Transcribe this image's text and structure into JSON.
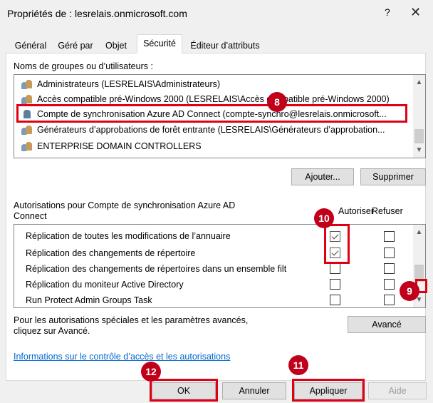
{
  "window": {
    "title": "Propriétés de : lesrelais.onmicrosoft.com",
    "help_label": "?",
    "close_label": "✕"
  },
  "tabs": [
    {
      "label": "Général"
    },
    {
      "label": "Géré par"
    },
    {
      "label": "Objet"
    },
    {
      "label": "Sécurité",
      "active": true
    },
    {
      "label": "Éditeur d’attributs"
    }
  ],
  "groups": {
    "label": "Noms de groupes ou d’utilisateurs :",
    "items": [
      {
        "label": "Administrateurs (LESRELAIS\\Administrateurs)",
        "icon": "group-icon"
      },
      {
        "label": "Accès compatible pré-Windows 2000 (LESRELAIS\\Accès compatible pré-Windows 2000)",
        "icon": "group-icon"
      },
      {
        "label": "Compte de synchronisation Azure AD Connect (compte-synchro@lesrelais.onmicrosoft...",
        "icon": "user-icon",
        "selected": true
      },
      {
        "label": "Générateurs d’approbations de forêt entrante (LESRELAIS\\Générateurs d’approbation...",
        "icon": "group-icon"
      },
      {
        "label": "ENTERPRISE DOMAIN CONTROLLERS",
        "icon": "group-icon"
      }
    ],
    "add_label": "Ajouter...",
    "remove_label": "Supprimer"
  },
  "permissions": {
    "title": "Autorisations pour Compte de synchronisation Azure AD Connect",
    "allow_label": "Autoriser",
    "deny_label": "Refuser",
    "items": [
      {
        "label": "Réplication de toutes les modifications de l’annuaire",
        "allow": true,
        "deny": false
      },
      {
        "label": "Réplication des changements de répertoire",
        "allow": true,
        "deny": false
      },
      {
        "label": "Réplication des changements de répertoires dans un ensemble filt",
        "allow": false,
        "deny": false
      },
      {
        "label": "Réplication du moniteur Active Directory",
        "allow": false,
        "deny": false
      },
      {
        "label": "Run Protect Admin Groups Task",
        "allow": false,
        "deny": false
      }
    ]
  },
  "special": {
    "text": "Pour les autorisations spéciales et les paramètres avancés, cliquez sur Avancé.",
    "advanced_label": "Avancé"
  },
  "link_label": "Informations sur le contrôle d’accès et les autorisations",
  "footer": {
    "ok_label": "OK",
    "cancel_label": "Annuler",
    "apply_label": "Appliquer",
    "help_label": "Aide"
  },
  "badges": [
    "8",
    "9",
    "10",
    "11",
    "12"
  ],
  "colors": {
    "highlight": "#e00014",
    "badge": "#c0001a",
    "link": "#0066cc"
  }
}
